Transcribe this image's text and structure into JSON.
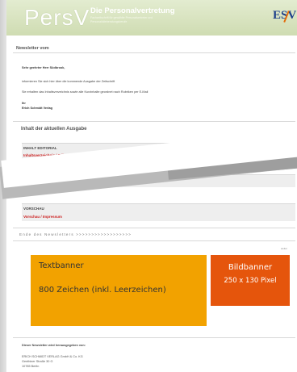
{
  "header": {
    "logo_word": "PersV",
    "title": "Die Personalvertretung",
    "subtitle": "Fachzeitschrift für gewählte Personalvertreter und Personalräteberatungsberufe",
    "publisher_logo": "ESV"
  },
  "newsletter_title": "Newsletter vom",
  "intro": {
    "greeting": "Sehr geehrter Herr Südbrook,",
    "line1": "informieren Sie sich hier über die kommende Ausgabe der Zeitschrift",
    "line2": "Sie erhalten das Inhaltsverzeichnis sowie alle Kurzinhalte geordnet nach Rubriken per E-Mail",
    "signoff1": "Ihr",
    "signoff2": "Erich Schmidt Verlag"
  },
  "contents_heading": "Inhalt der aktuellen Ausgabe",
  "sections": {
    "editorial_head": "INHALT EDITORIAL",
    "editorial_link": "Inhaltsverzeichnis / Editorial",
    "editorial_author": "Ralf Pieper",
    "aktuelles_head": "AKTUELLES",
    "aktuelles_link": "Meldungen - Rezension - Rezension",
    "vorschau_head": "VORSCHAU",
    "vorschau_link": "Vorschau / Impressum"
  },
  "end_text": "Ende des Newsletters >>>>>>>>>>>>>>>>>>",
  "weiter_label": "weiter",
  "textbanner": {
    "title": "Textbanner",
    "description": "800 Zeichen (inkl. Leerzeichen)"
  },
  "bildbanner": {
    "title": "Bildbanner",
    "size": "250 x 130 Pixel"
  },
  "footer": {
    "heading": "Dieser Newsletter wird herausgegeben von:",
    "company": "ERICH SCHMIDT VERLAG GmbH & Co. KG",
    "street": "Genthiner Straße 30 G",
    "city": "10785 Berlin"
  },
  "colors": {
    "header_green": "#cfdcb2",
    "textbanner": "#f2a200",
    "bildbanner": "#e5550c",
    "link_red": "#cc1f1f",
    "esv_blue": "#1c3f8a"
  }
}
